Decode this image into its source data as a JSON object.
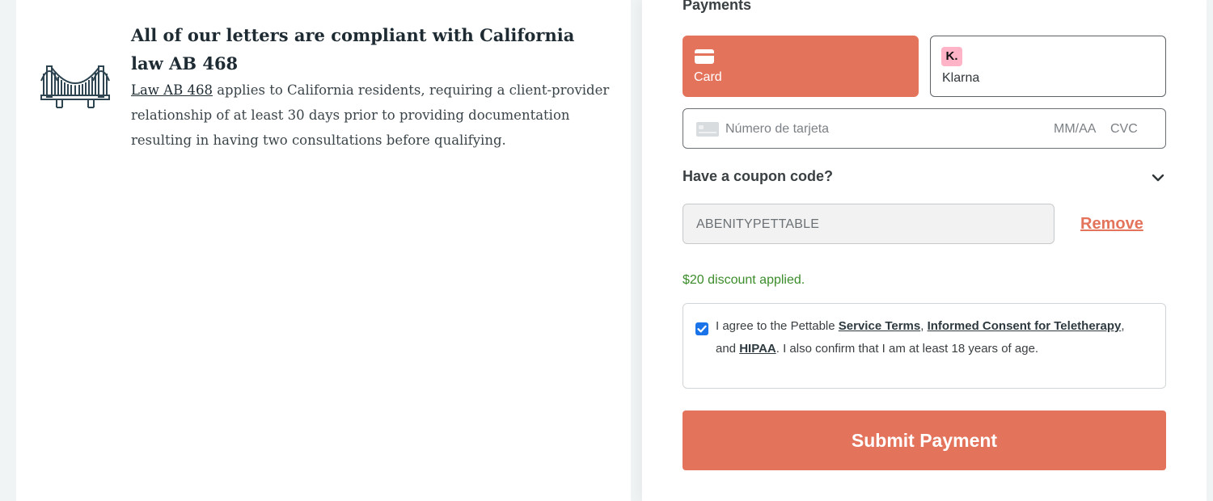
{
  "info": {
    "title": "All of our letters are compliant with California law AB 468",
    "law_link": "Law AB 468",
    "body": " applies to California residents, requiring a client-provider relationship of at least 30 days prior to providing documentation resulting in having two consultations before qualifying."
  },
  "payments": {
    "heading": "Payments",
    "methods": [
      {
        "label": "Card",
        "icon": "credit-card-icon",
        "selected": true
      },
      {
        "label": "Klarna",
        "icon": "klarna-logo",
        "badge": "K.",
        "selected": false
      }
    ],
    "card_number_placeholder": "Número de tarjeta",
    "expiry_placeholder": "MM/AA",
    "cvc_placeholder": "CVC"
  },
  "coupon": {
    "toggle_label": "Have a coupon code?",
    "value": "ABENITYPETTABLE",
    "remove_label": "Remove",
    "message": "$20 discount applied."
  },
  "agreement": {
    "checked": true,
    "prefix": "I agree to the Pettable ",
    "service_terms": "Service Terms",
    "sep1": ", ",
    "informed_consent": "Informed Consent for Teletherapy",
    "sep2": ", and ",
    "hipaa": "HIPAA",
    "suffix": ". I also confirm that I am at least 18 years of age."
  },
  "submit_label": "Submit Payment",
  "colors": {
    "accent": "#e4735b",
    "success": "#3b8c2a",
    "checkbox": "#1a73e8",
    "klarna_pink": "#ffb3c7"
  }
}
